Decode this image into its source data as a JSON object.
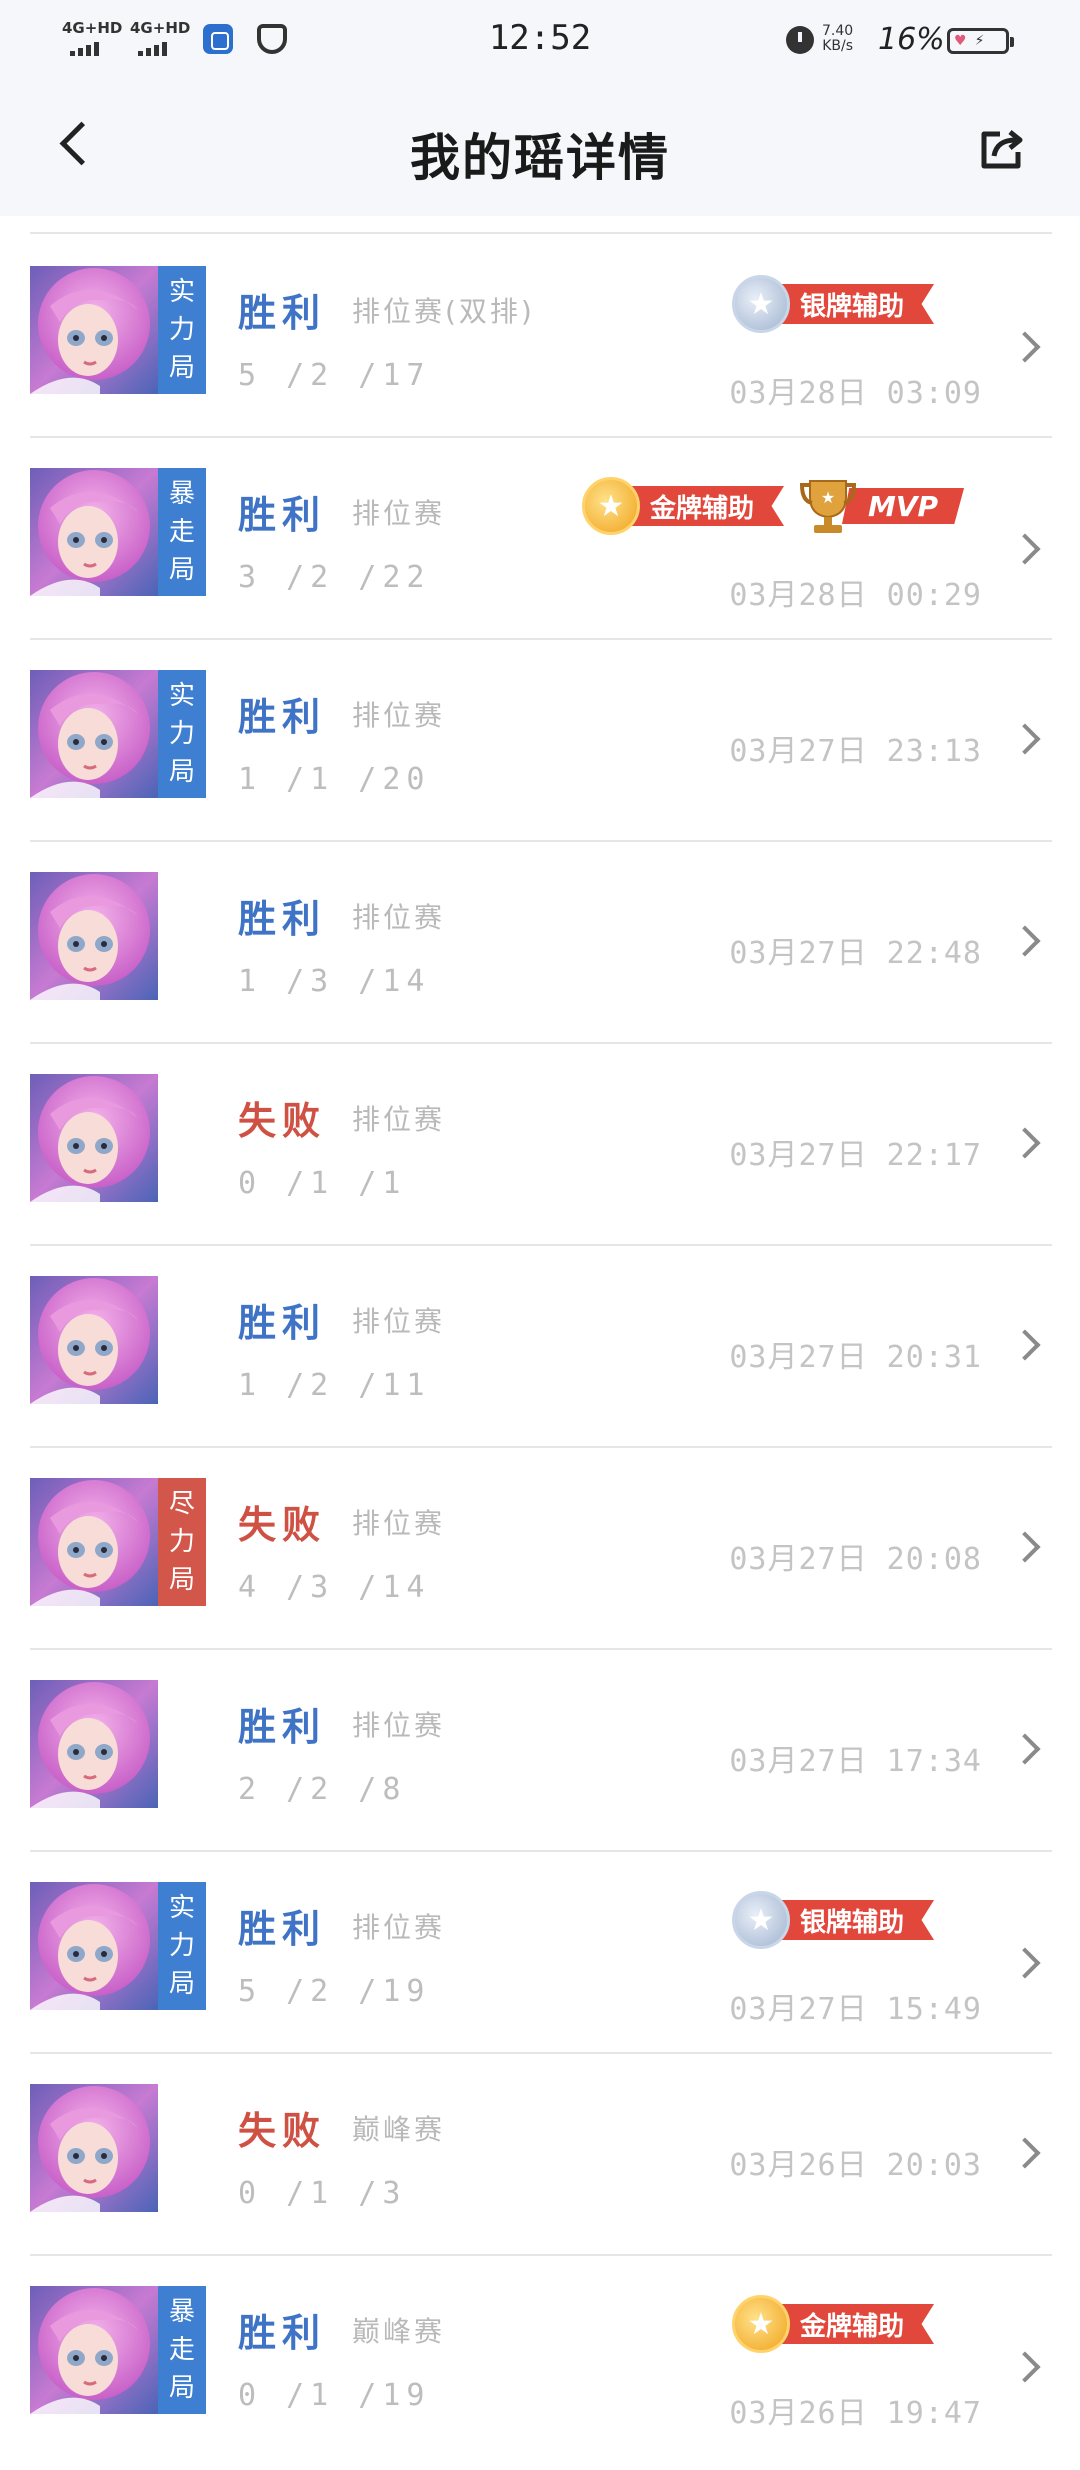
{
  "status_bar": {
    "signal1": "4G+HD",
    "signal2": "4G+HD",
    "time": "12:52",
    "net_speed_value": "7.40",
    "net_speed_unit": "KB/s",
    "battery": "16%"
  },
  "nav": {
    "title": "我的瑶详情",
    "back_icon": "chevron-left-icon",
    "share_icon": "share-icon"
  },
  "matches": [
    {
      "result": "胜利",
      "outcome": "win",
      "mode": "排位赛(双排)",
      "kda": "5 /2 /17",
      "time": "03月28日  03:09",
      "tag": "实力局",
      "tag_color": "blue",
      "badge": "银牌辅助",
      "badge_type": "silver",
      "mvp": ""
    },
    {
      "result": "胜利",
      "outcome": "win",
      "mode": "排位赛",
      "kda": "3 /2 /22",
      "time": "03月28日  00:29",
      "tag": "暴走局",
      "tag_color": "blue",
      "badge": "金牌辅助",
      "badge_type": "gold",
      "mvp": "MVP"
    },
    {
      "result": "胜利",
      "outcome": "win",
      "mode": "排位赛",
      "kda": "1 /1 /20",
      "time": "03月27日  23:13",
      "tag": "实力局",
      "tag_color": "blue",
      "badge": "",
      "badge_type": "",
      "mvp": ""
    },
    {
      "result": "胜利",
      "outcome": "win",
      "mode": "排位赛",
      "kda": "1 /3 /14",
      "time": "03月27日  22:48",
      "tag": "",
      "tag_color": "",
      "badge": "",
      "badge_type": "",
      "mvp": ""
    },
    {
      "result": "失败",
      "outcome": "lose",
      "mode": "排位赛",
      "kda": "0 /1 /1",
      "time": "03月27日  22:17",
      "tag": "",
      "tag_color": "",
      "badge": "",
      "badge_type": "",
      "mvp": ""
    },
    {
      "result": "胜利",
      "outcome": "win",
      "mode": "排位赛",
      "kda": "1 /2 /11",
      "time": "03月27日  20:31",
      "tag": "",
      "tag_color": "",
      "badge": "",
      "badge_type": "",
      "mvp": ""
    },
    {
      "result": "失败",
      "outcome": "lose",
      "mode": "排位赛",
      "kda": "4 /3 /14",
      "time": "03月27日  20:08",
      "tag": "尽力局",
      "tag_color": "red",
      "badge": "",
      "badge_type": "",
      "mvp": ""
    },
    {
      "result": "胜利",
      "outcome": "win",
      "mode": "排位赛",
      "kda": "2 /2 /8",
      "time": "03月27日  17:34",
      "tag": "",
      "tag_color": "",
      "badge": "",
      "badge_type": "",
      "mvp": ""
    },
    {
      "result": "胜利",
      "outcome": "win",
      "mode": "排位赛",
      "kda": "5 /2 /19",
      "time": "03月27日  15:49",
      "tag": "实力局",
      "tag_color": "blue",
      "badge": "银牌辅助",
      "badge_type": "silver",
      "mvp": ""
    },
    {
      "result": "失败",
      "outcome": "lose",
      "mode": "巅峰赛",
      "kda": "0 /1 /3",
      "time": "03月26日  20:03",
      "tag": "",
      "tag_color": "",
      "badge": "",
      "badge_type": "",
      "mvp": ""
    },
    {
      "result": "胜利",
      "outcome": "win",
      "mode": "巅峰赛",
      "kda": "0 /1 /19",
      "time": "03月26日  19:47",
      "tag": "暴走局",
      "tag_color": "blue",
      "badge": "金牌辅助",
      "badge_type": "gold",
      "mvp": ""
    }
  ]
}
